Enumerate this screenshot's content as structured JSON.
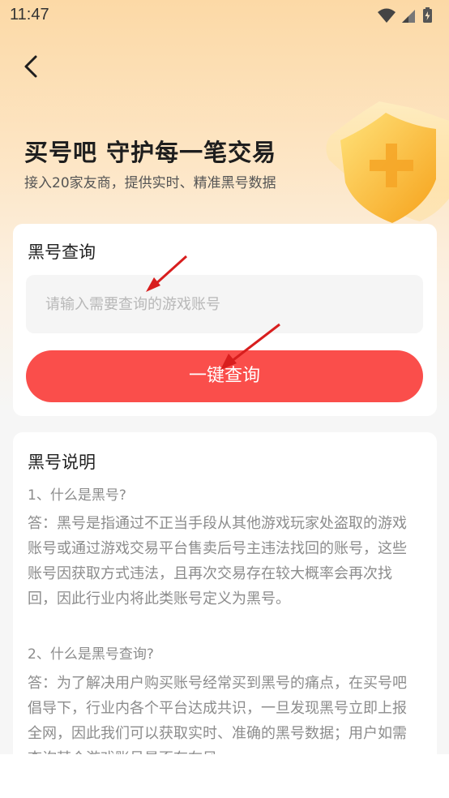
{
  "status_bar": {
    "time": "11:47"
  },
  "hero": {
    "title": "买号吧 守护每一笔交易",
    "subtitle": "接入20家友商，提供实时、精准黑号数据"
  },
  "query_card": {
    "title": "黑号查询",
    "input_placeholder": "请输入需要查询的游戏账号",
    "input_value": "",
    "button_label": "一键查询"
  },
  "explain_card": {
    "title": "黑号说明",
    "q1": "1、什么是黑号?",
    "a1": "答：黑号是指通过不正当手段从其他游戏玩家处盗取的游戏账号或通过游戏交易平台售卖后号主违法找回的账号，这些账号因获取方式违法，且再次交易存在较大概率会再次找回，因此行业内将此类账号定义为黑号。",
    "q2": "2、什么是黑号查询?",
    "a2": "答：为了解决用户购买账号经常买到黑号的痛点，在买号吧倡导下，行业内各个平台达成共识，一旦发现黑号立即上报全网，因此我们可以获取实时、准确的黑号数据；用户如需查询某个游戏账号是否存在风"
  },
  "colors": {
    "accent": "#fa4e4b",
    "header_gradient_top": "#fcd9a6",
    "annotation_arrow": "#d81e1e"
  }
}
